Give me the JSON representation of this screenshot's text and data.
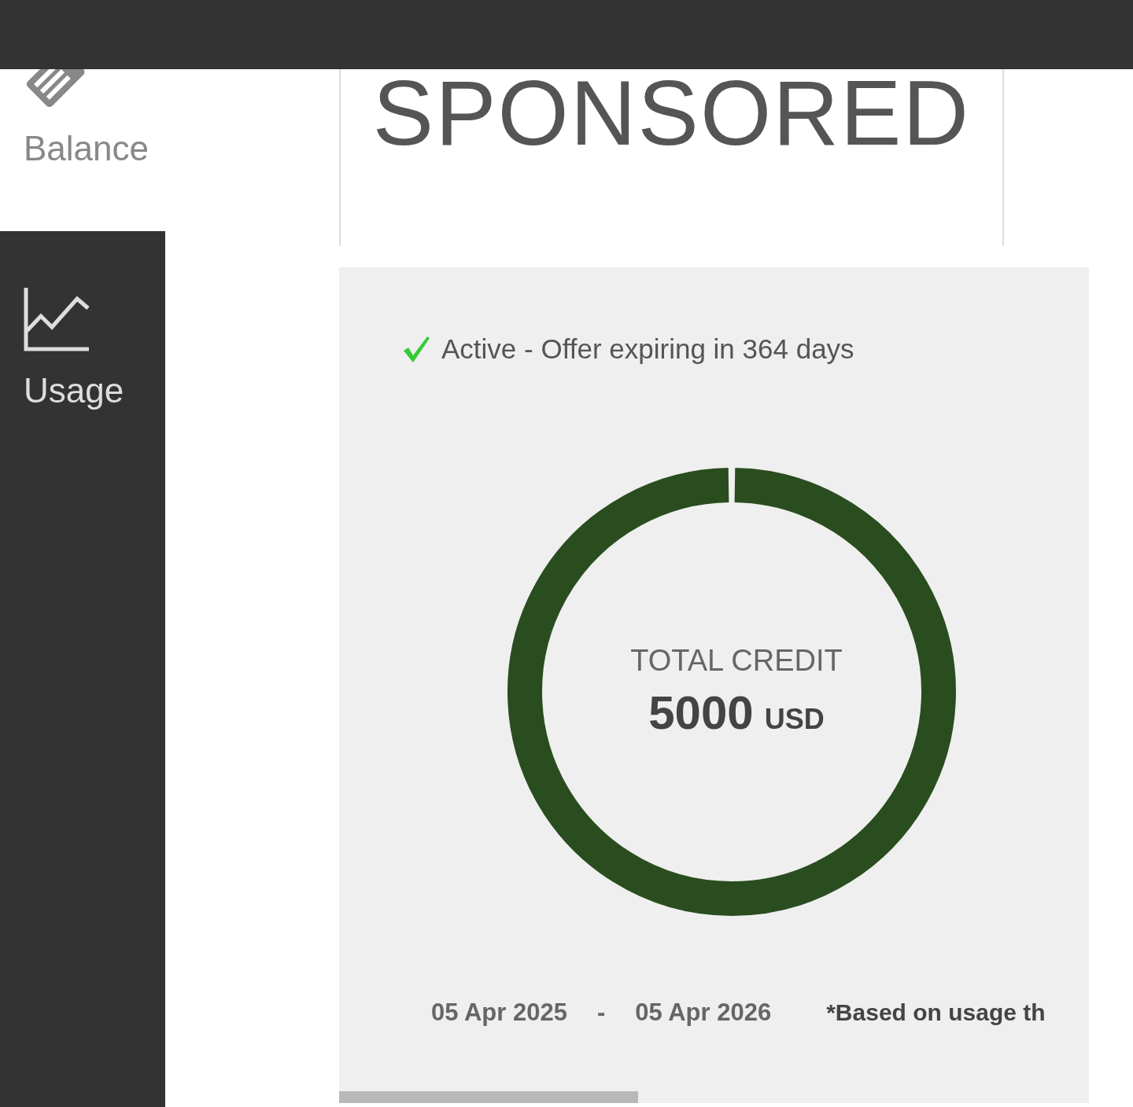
{
  "sidebar": {
    "items": [
      {
        "label": "Balance",
        "kind": "tag",
        "selected": true
      },
      {
        "label": "Usage",
        "kind": "chart",
        "selected": false
      }
    ]
  },
  "offer": {
    "title": "SPONSORED"
  },
  "credit": {
    "status": "Active - Offer expiring in 364 days",
    "active": true,
    "caption": "TOTAL CREDIT",
    "amount": "5000",
    "currency": "USD",
    "start": "05 Apr 2025",
    "separator": "-",
    "end": "05 Apr 2026",
    "note": "*Based on usage th"
  }
}
